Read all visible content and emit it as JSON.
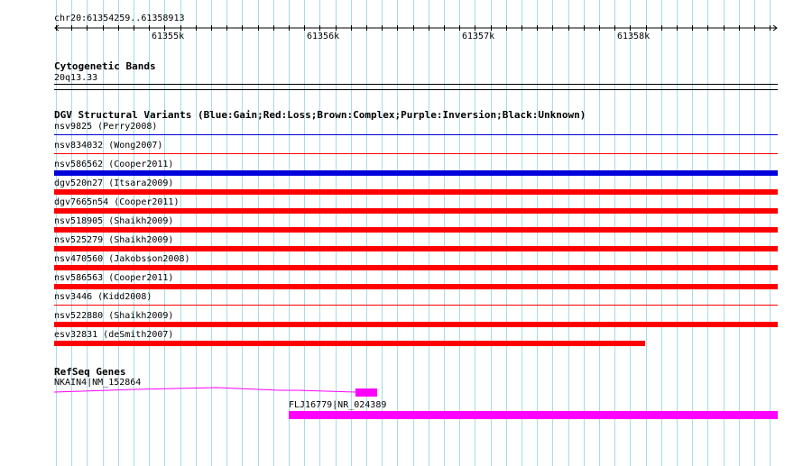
{
  "ruler": {
    "location": "chr20:61354259..61358913",
    "ticks": [
      "61355k",
      "61356k",
      "61357k",
      "61358k"
    ]
  },
  "cytobands": {
    "title": "Cytogenetic Bands",
    "band": "20q13.33"
  },
  "dgv": {
    "title": "DGV Structural Variants (Blue:Gain;Red:Loss;Brown:Complex;Purple:Inversion;Black:Unknown)",
    "colors": {
      "gain": "#0000dd",
      "loss": "#ff0000"
    },
    "variants": [
      {
        "label": "nsv9825 (Perry2008)",
        "type": "gain",
        "bar": "thin"
      },
      {
        "label": "nsv834032 (Wong2007)",
        "type": "loss",
        "bar": "thin"
      },
      {
        "label": "nsv586562 (Cooper2011)",
        "type": "gain",
        "bar": "thick"
      },
      {
        "label": "dgv520n27 (Itsara2009)",
        "type": "loss",
        "bar": "thick"
      },
      {
        "label": "dgv7665n54 (Cooper2011)",
        "type": "loss",
        "bar": "thick"
      },
      {
        "label": "nsv518905 (Shaikh2009)",
        "type": "loss",
        "bar": "thick"
      },
      {
        "label": "nsv525279 (Shaikh2009)",
        "type": "loss",
        "bar": "thick"
      },
      {
        "label": "nsv470560 (Jakobsson2008)",
        "type": "loss",
        "bar": "thick"
      },
      {
        "label": "nsv586563 (Cooper2011)",
        "type": "loss",
        "bar": "thick"
      },
      {
        "label": "nsv3446 (Kidd2008)",
        "type": "loss",
        "bar": "thin"
      },
      {
        "label": "nsv522880 (Shaikh2009)",
        "type": "loss",
        "bar": "thick"
      },
      {
        "label": "esv32831 (deSmith2007)",
        "type": "loss",
        "bar": "thick"
      }
    ]
  },
  "refseq": {
    "title": "RefSeq Genes",
    "color": "#ff00ff",
    "genes": [
      {
        "label": "NKAIN4|NM_152864"
      },
      {
        "label": "FLJ16779|NR_024389"
      }
    ]
  }
}
